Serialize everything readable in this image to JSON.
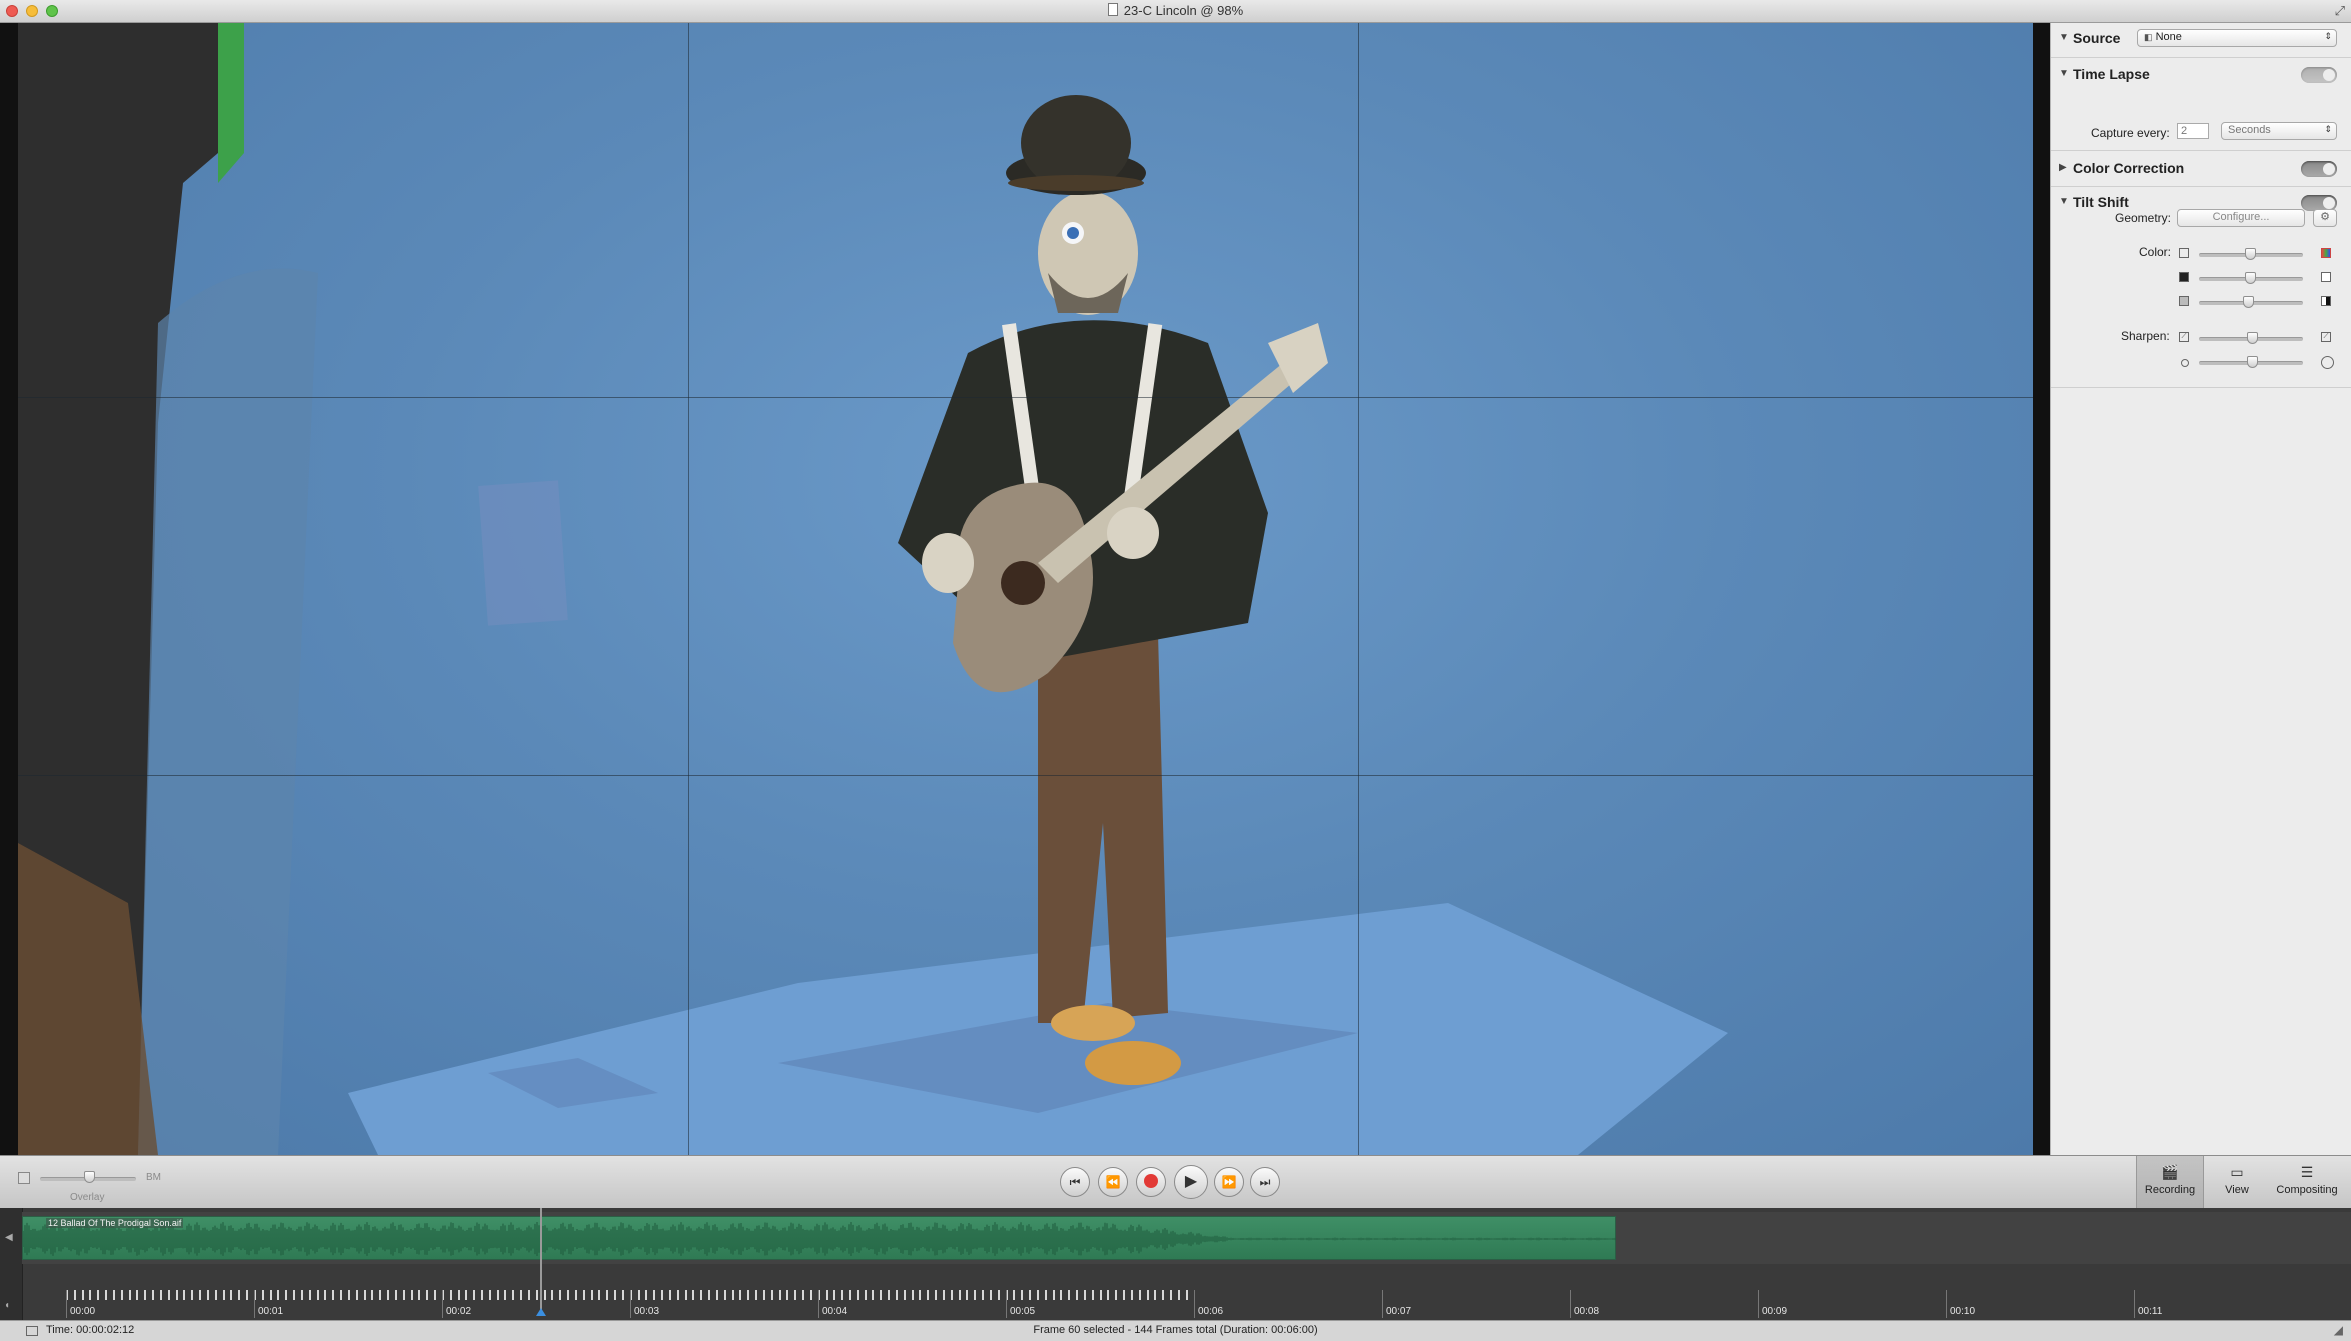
{
  "window": {
    "title": "23-C Lincoln @ 98%"
  },
  "inspector": {
    "source": {
      "title": "Source",
      "value": "None"
    },
    "time_lapse": {
      "title": "Time Lapse",
      "capture_label": "Capture every:",
      "capture_value": "2",
      "unit": "Seconds"
    },
    "color_correction": {
      "title": "Color Correction"
    },
    "tilt_shift": {
      "title": "Tilt Shift",
      "geometry_label": "Geometry:",
      "configure_label": "Configure...",
      "color_label": "Color:",
      "sharpen_label": "Sharpen:"
    }
  },
  "transport": {
    "overlay_label": "Overlay",
    "overlay_right": "BM",
    "modes": [
      {
        "label": "Recording",
        "icon": "clapper-icon"
      },
      {
        "label": "View",
        "icon": "monitor-icon"
      },
      {
        "label": "Compositing",
        "icon": "layers-icon"
      }
    ]
  },
  "timeline": {
    "audio_clip": "12 Ballad Of The Prodigal Son.aif",
    "ticks": [
      "00:00",
      "00:01",
      "00:02",
      "00:03",
      "00:04",
      "00:05",
      "00:06",
      "00:07",
      "00:08",
      "00:09",
      "00:10",
      "00:11"
    ]
  },
  "status": {
    "time": "Time: 00:00:02:12",
    "info": "Frame 60 selected - 144 Frames total (Duration: 00:06:00)"
  }
}
